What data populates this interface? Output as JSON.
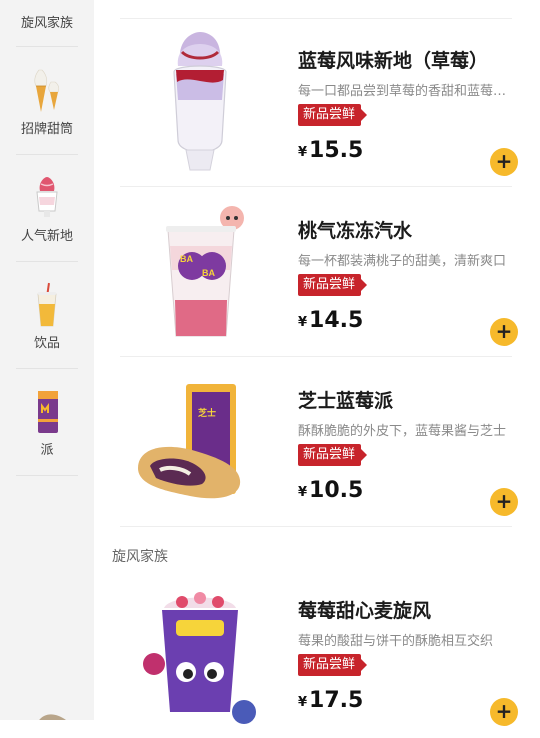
{
  "sidebar": {
    "categories": [
      {
        "label": "旋风家族",
        "icon": "mcflurry-icon"
      },
      {
        "label": "招牌甜筒",
        "icon": "ice-cream-cone-icon"
      },
      {
        "label": "人气新地",
        "icon": "sundae-icon"
      },
      {
        "label": "饮品",
        "icon": "drink-cup-icon"
      },
      {
        "label": "派",
        "icon": "pie-box-icon"
      }
    ]
  },
  "section": {
    "title": "旋风家族"
  },
  "products": [
    {
      "name": "蓝莓风味新地（草莓）",
      "desc": "每一口都品尝到草莓的香甜和蓝莓的清新",
      "badge": "新品尝鲜",
      "currency": "¥",
      "price": "15.5",
      "add": "+"
    },
    {
      "name": "桃气冻冻汽水",
      "desc": "每一杯都装满桃子的甜美，清新爽口",
      "badge": "新品尝鲜",
      "currency": "¥",
      "price": "14.5",
      "add": "+"
    },
    {
      "name": "芝士蓝莓派",
      "desc": "酥酥脆脆的外皮下，蓝莓果酱与芝士",
      "badge": "新品尝鲜",
      "currency": "¥",
      "price": "10.5",
      "add": "+"
    },
    {
      "name": "莓莓甜心麦旋风",
      "desc": "莓果的酸甜与饼干的酥脆相互交织",
      "badge": "新品尝鲜",
      "currency": "¥",
      "price": "17.5",
      "add": "+"
    }
  ],
  "colors": {
    "accent": "#f6b92b",
    "badge": "#c7242b",
    "sidebar_bg": "#f3f3f3"
  }
}
